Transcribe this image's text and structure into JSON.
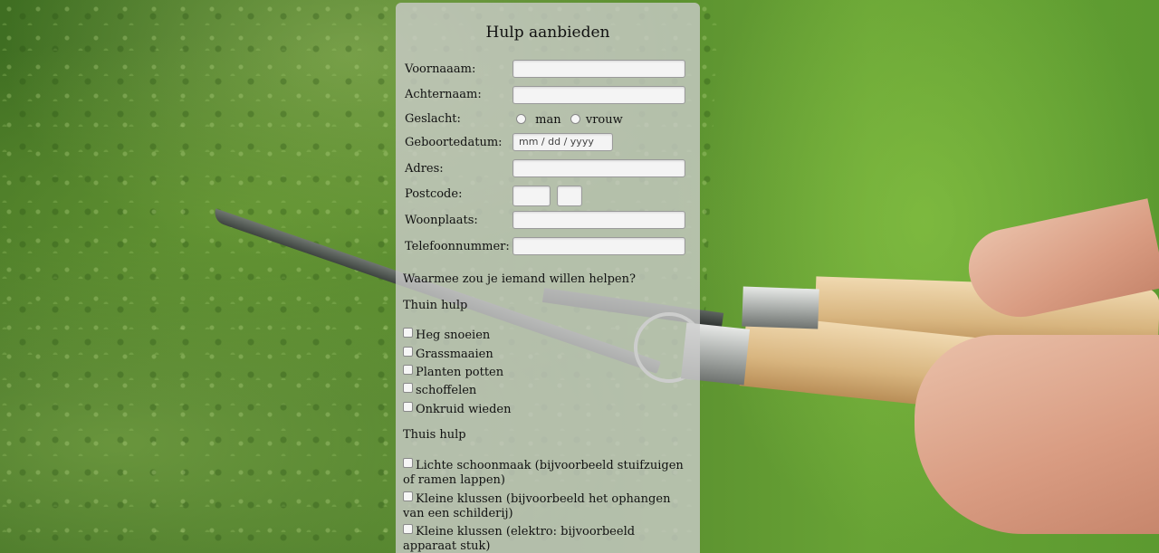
{
  "form": {
    "title": "Hulp aanbieden",
    "fields": {
      "voornaam_label": "Voornaaam:",
      "achternaam_label": "Achternaam:",
      "geslacht_label": "Geslacht:",
      "geslacht_options": [
        "man",
        "vrouw"
      ],
      "geboortedatum_label": "Geboortedatum:",
      "geboortedatum_placeholder": "mm / dd / yyyy",
      "adres_label": "Adres:",
      "postcode_label": "Postcode:",
      "woonplaats_label": "Woonplaats:",
      "telefoon_label": "Telefoonnummer:"
    },
    "question": "Waarmee zou je iemand willen helpen?",
    "sections": {
      "thuin": {
        "title": "Thuin hulp",
        "options": [
          "Heg snoeien",
          "Grassmaaien",
          "Planten potten",
          "schoffelen",
          "Onkruid wieden"
        ]
      },
      "thuis": {
        "title": "Thuis hulp",
        "options": [
          "Lichte schoonmaak (bijvoorbeeld stuifzuigen of ramen lappen)",
          "Kleine klussen (bijvoorbeeld het ophangen van een schilderij)",
          "Kleine klussen (elektro: bijvoorbeeld apparaat stuk)"
        ]
      }
    }
  }
}
